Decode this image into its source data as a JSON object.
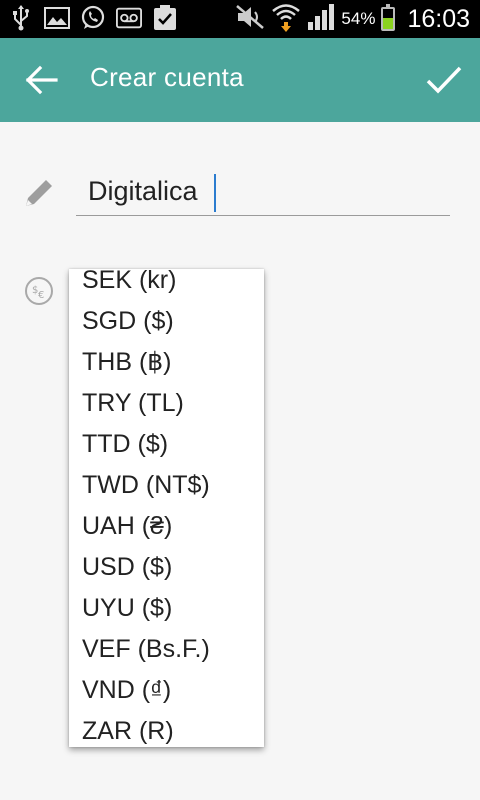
{
  "status_bar": {
    "battery_percent": "54%",
    "time": "16:03",
    "battery_level": 0.54
  },
  "toolbar": {
    "title": "Crear cuenta"
  },
  "form": {
    "name_value": "Digitalica"
  },
  "currency_dropdown": {
    "options": [
      "SEK (kr)",
      "SGD ($)",
      "THB (฿)",
      "TRY (TL)",
      "TTD ($)",
      "TWD (NT$)",
      "UAH (₴)",
      "USD ($)",
      "UYU ($)",
      "VEF (Bs.F.)",
      "VND (₫)",
      "ZAR (R)"
    ]
  },
  "colors": {
    "toolbar": "#4ca69c",
    "background": "#f6f6f6"
  },
  "icons": [
    "usb-icon",
    "gallery-icon",
    "whatsapp-icon",
    "voicemail-icon",
    "clipboard-icon",
    "mute-icon",
    "wifi-icon",
    "signal-icon",
    "battery-icon",
    "back-arrow-icon",
    "check-icon",
    "pencil-icon",
    "currency-icon"
  ]
}
